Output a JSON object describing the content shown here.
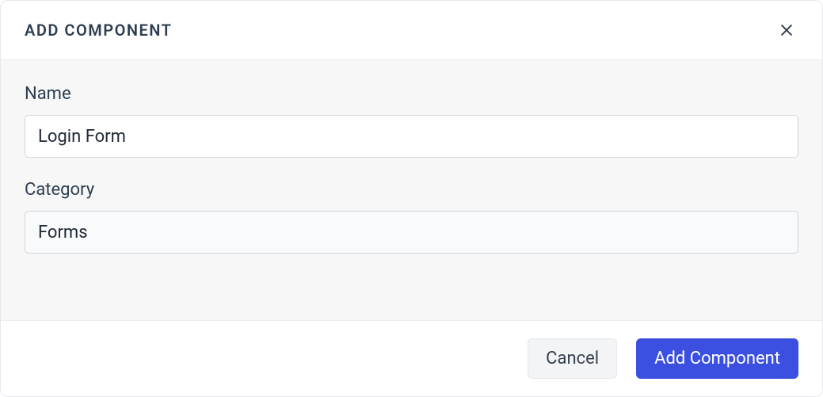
{
  "modal": {
    "title": "ADD COMPONENT",
    "fields": {
      "name": {
        "label": "Name",
        "value": "Login Form"
      },
      "category": {
        "label": "Category",
        "value": "Forms"
      }
    },
    "footer": {
      "cancel_label": "Cancel",
      "submit_label": "Add Component"
    }
  }
}
